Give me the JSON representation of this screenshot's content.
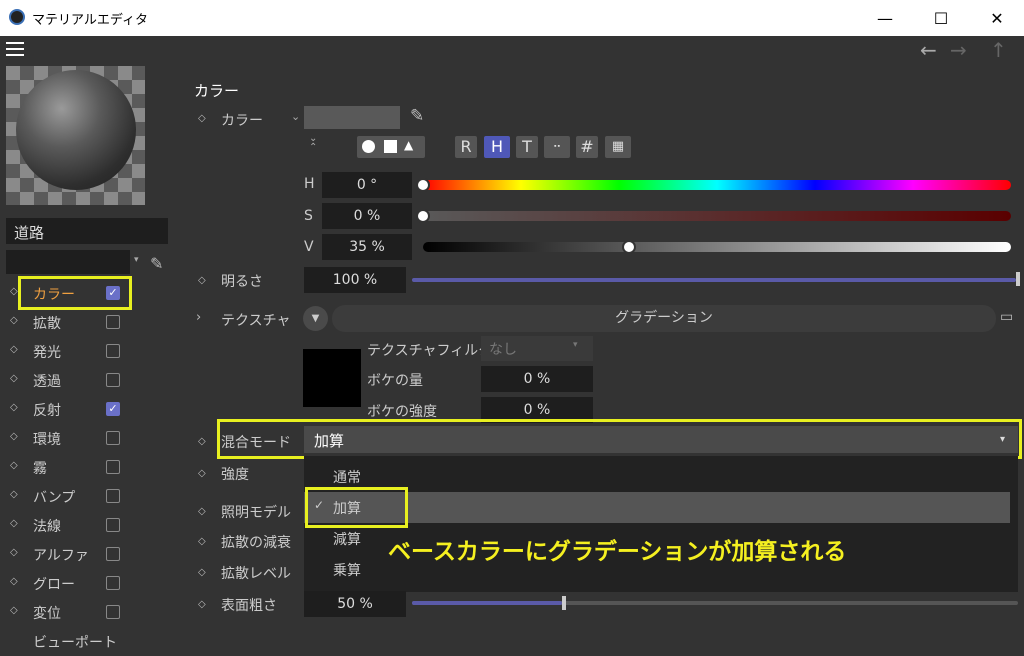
{
  "window": {
    "title": "マテリアルエディタ",
    "minimize": "—",
    "maximize": "☐",
    "close": "✕"
  },
  "nav": {
    "back": "←",
    "forward": "→",
    "up": "↑"
  },
  "material": {
    "name": "道路"
  },
  "channels": [
    {
      "label": "カラー",
      "checked": true
    },
    {
      "label": "拡散",
      "checked": false
    },
    {
      "label": "発光",
      "checked": false
    },
    {
      "label": "透過",
      "checked": false
    },
    {
      "label": "反射",
      "checked": true
    },
    {
      "label": "環境",
      "checked": false
    },
    {
      "label": "霧",
      "checked": false
    },
    {
      "label": "バンプ",
      "checked": false
    },
    {
      "label": "法線",
      "checked": false
    },
    {
      "label": "アルファ",
      "checked": false
    },
    {
      "label": "グロー",
      "checked": false
    },
    {
      "label": "変位",
      "checked": false
    }
  ],
  "viewport_label": "ビューポート",
  "section": {
    "title": "カラー"
  },
  "color": {
    "label": "カラー",
    "swatch": "#595959",
    "modes": [
      "R",
      "H",
      "T",
      "⠒",
      "#",
      "▦"
    ],
    "h_label": "H",
    "h_value": "0 °",
    "s_label": "S",
    "s_value": "0 %",
    "v_label": "V",
    "v_value": "35 %",
    "h_level": 0,
    "s_level": 0,
    "v_level": 0.35
  },
  "brightness": {
    "label": "明るさ",
    "value": "100 %",
    "level": 1.0
  },
  "texture": {
    "label": "テクスチャ",
    "button": "グラデーション",
    "filter_label": "テクスチャフィルタ",
    "filter_value": "なし",
    "blur_label": "ボケの量",
    "blur_value": "0 %",
    "blur_strength_label": "ボケの強度",
    "blur_strength_value": "0 %"
  },
  "blend": {
    "label": "混合モード",
    "value": "加算",
    "options": [
      "通常",
      "加算",
      "減算",
      "乗算"
    ],
    "check": "✓"
  },
  "props": {
    "strength": "強度",
    "lighting": "照明モデル",
    "diffuse_falloff": "拡散の減衰",
    "diffuse_level": "拡散レベル",
    "roughness": "表面粗さ",
    "roughness_value": "50 %",
    "roughness_level": 0.5
  },
  "annotation": "ベースカラーにグラデーションが加算される",
  "colors": {
    "highlight": "#e8f020",
    "accent": "#6a70c8",
    "annotation": "#f5f020"
  }
}
